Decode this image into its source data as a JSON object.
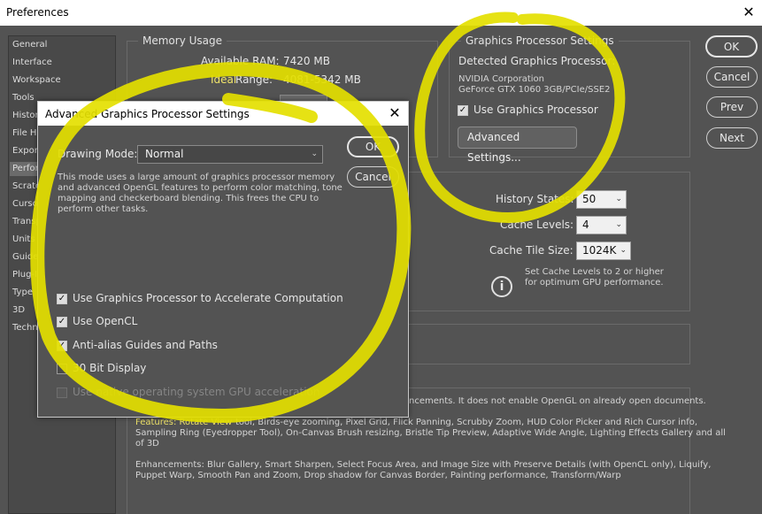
{
  "window": {
    "title": "Preferences",
    "close_glyph": "✕"
  },
  "sidebar": {
    "items": [
      "General",
      "Interface",
      "Workspace",
      "Tools",
      "History",
      "File Ha",
      "Export",
      "Perfor",
      "Scratch",
      "Cursor",
      "Transp",
      "Units &",
      "Guides",
      "Plug-I",
      "Type",
      "3D",
      "Techn"
    ],
    "selected_index": 7
  },
  "memory": {
    "legend": "Memory Usage",
    "available_label": "Available RAM:",
    "available_value": "7420 MB",
    "ideal_prefix": "Ideal",
    "ideal_suffix": " Range:",
    "ideal_value": "4081-5342 MB"
  },
  "gpu": {
    "legend": "Graphics Processor Settings",
    "detected_label": "Detected Graphics Processor:",
    "vendor": "NVIDIA Corporation",
    "model": "GeForce GTX 1060 3GB/PCIe/SSE2",
    "use_gpu_label": "Use Graphics Processor",
    "use_gpu_checked": true,
    "advanced_button": "Advanced Settings..."
  },
  "buttons": {
    "ok": "OK",
    "cancel": "Cancel",
    "prev": "Prev",
    "next": "Next"
  },
  "history": {
    "history_states_label": "History States:",
    "history_states_value": "50",
    "cache_levels_label": "Cache Levels:",
    "cache_levels_value": "4",
    "cache_tile_label": "Cache Tile Size:",
    "cache_tile_value": "1024K",
    "hint": "Set Cache Levels to 2 or higher for optimum GPU performance."
  },
  "description": {
    "line1": "ncements. It does not enable OpenGL on already open documents.",
    "features_prefix": "Features: Rotate View",
    "features_rest": " tool, Birds-eye zooming, Pixel Grid, Flick Panning, Scrubby Zoom, HUD Color Picker and Rich Cursor info,",
    "features_line2": "Sampling Ring (Eyedropper Tool), On-Canvas Brush resizing, Bristle Tip Preview, Adaptive Wide Angle, Lighting Effects Gallery and all",
    "features_line3": "of 3D",
    "enh_line1": "Enhancements: Blur Gallery, Smart Sharpen, Select Focus Area, and Image Size with Preserve Details (with OpenCL only), Liquify,",
    "enh_line2": "Puppet Warp, Smooth Pan and Zoom, Drop shadow for Canvas Border, Painting performance, Transform/Warp"
  },
  "dialog": {
    "title": "Advanced Graphics Processor Settings",
    "close_glyph": "✕",
    "drawing_mode_label": "Drawing Mode:",
    "drawing_mode_value": "Normal",
    "ok": "OK",
    "cancel": "Cancel",
    "mode_desc_1": "This mode uses a large amount of graphics processor memory",
    "mode_desc_2": "and advanced OpenGL features to perform color matching, tone",
    "mode_desc_3": "mapping and checkerboard blending.  This frees the CPU to",
    "mode_desc_4": "perform other tasks.",
    "options": [
      {
        "label": "Use Graphics Processor to Accelerate Computation",
        "checked": true,
        "disabled": false
      },
      {
        "label": "Use OpenCL",
        "checked": true,
        "disabled": false
      },
      {
        "label": "Anti-alias Guides and Paths",
        "checked": true,
        "disabled": false
      },
      {
        "label": "30 Bit Display",
        "checked": false,
        "disabled": false
      },
      {
        "label": "Use native operating system GPU acceleration",
        "checked": false,
        "disabled": true
      }
    ]
  },
  "colors": {
    "highlight": "#e8e200",
    "annotation": "#e4e000",
    "ideal_text": "#f0e46a"
  },
  "icons": {
    "info": "info-circle-icon",
    "check": "checkmark-icon",
    "chevron": "chevron-down-icon"
  }
}
